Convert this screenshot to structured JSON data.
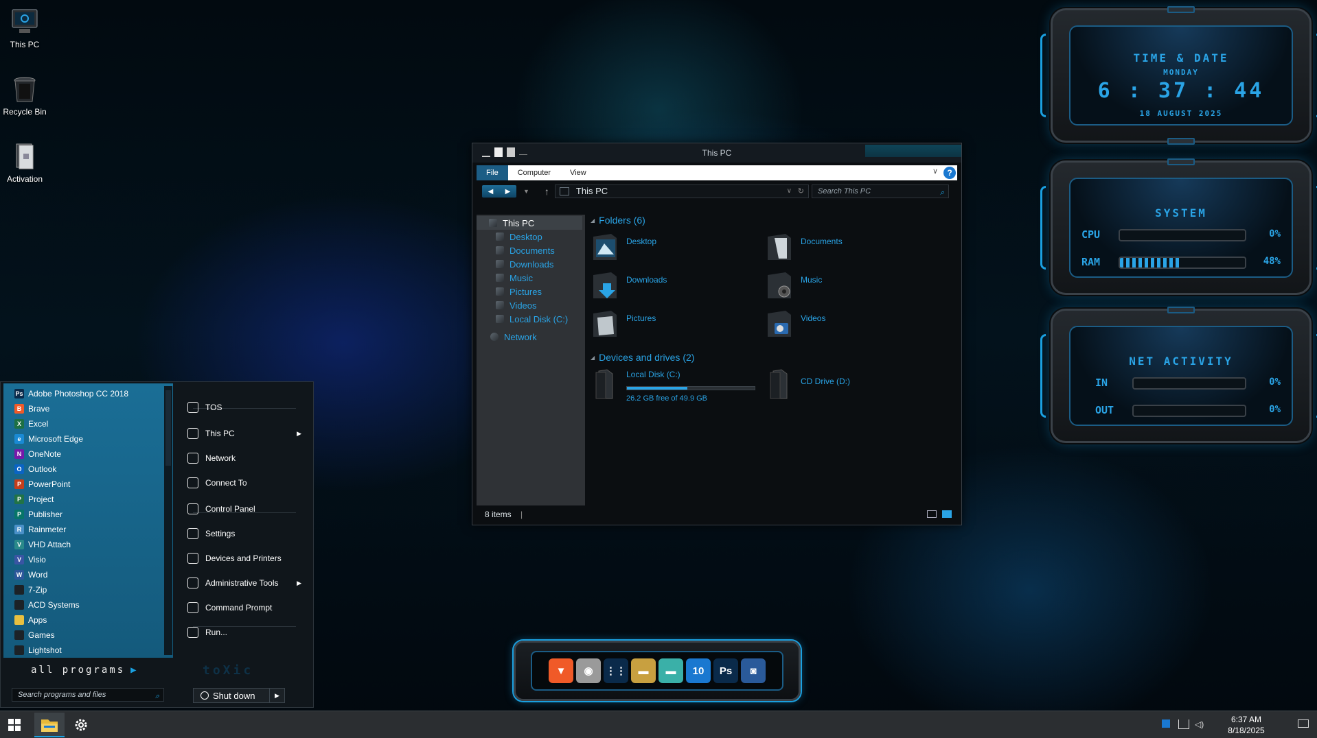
{
  "desktop": {
    "icons": [
      {
        "label": "This PC",
        "icon": "computer-icon"
      },
      {
        "label": "Recycle Bin",
        "icon": "recycle-bin-icon"
      },
      {
        "label": "Activation",
        "icon": "activation-icon"
      }
    ]
  },
  "explorer": {
    "title": "This PC",
    "ribbon_tabs": [
      "File",
      "Computer",
      "View"
    ],
    "address": "This PC",
    "search_placeholder": "Search This PC",
    "nav": {
      "root": "This PC",
      "items": [
        "Desktop",
        "Documents",
        "Downloads",
        "Music",
        "Pictures",
        "Videos",
        "Local Disk (C:)"
      ],
      "network": "Network"
    },
    "folders_heading": "Folders (6)",
    "folders": [
      "Desktop",
      "Documents",
      "Downloads",
      "Music",
      "Pictures",
      "Videos"
    ],
    "drives_heading": "Devices and drives (2)",
    "drives": [
      {
        "name": "Local Disk (C:)",
        "free": "26.2 GB free of 49.9 GB",
        "used_fraction": 0.475
      },
      {
        "name": "CD Drive (D:)"
      }
    ],
    "status": "8 items"
  },
  "start_menu": {
    "programs": [
      {
        "label": "Adobe Photoshop CC 2018",
        "icon": "photoshop-icon",
        "color": "#0a2a4a",
        "glyph": "Ps"
      },
      {
        "label": "Brave",
        "icon": "brave-icon",
        "color": "#f05a28",
        "glyph": "B"
      },
      {
        "label": "Excel",
        "icon": "excel-icon",
        "color": "#1d7044",
        "glyph": "X"
      },
      {
        "label": "Microsoft Edge",
        "icon": "edge-icon",
        "color": "#1a8ad4",
        "glyph": "e"
      },
      {
        "label": "OneNote",
        "icon": "onenote-icon",
        "color": "#7719aa",
        "glyph": "N"
      },
      {
        "label": "Outlook",
        "icon": "outlook-icon",
        "color": "#0a64c4",
        "glyph": "O"
      },
      {
        "label": "PowerPoint",
        "icon": "powerpoint-icon",
        "color": "#c43e1c",
        "glyph": "P"
      },
      {
        "label": "Project",
        "icon": "project-icon",
        "color": "#217346",
        "glyph": "P"
      },
      {
        "label": "Publisher",
        "icon": "publisher-icon",
        "color": "#077568",
        "glyph": "P"
      },
      {
        "label": "Rainmeter",
        "icon": "rainmeter-icon",
        "color": "#4a90c8",
        "glyph": "R"
      },
      {
        "label": "VHD Attach",
        "icon": "vhd-attach-icon",
        "color": "#2a8a8a",
        "glyph": "V"
      },
      {
        "label": "Visio",
        "icon": "visio-icon",
        "color": "#3955a3",
        "glyph": "V"
      },
      {
        "label": "Word",
        "icon": "word-icon",
        "color": "#2b579a",
        "glyph": "W"
      },
      {
        "label": "7-Zip",
        "icon": "folder-icon",
        "color": "#1c2227",
        "glyph": ""
      },
      {
        "label": "ACD Systems",
        "icon": "folder-icon",
        "color": "#1c2227",
        "glyph": ""
      },
      {
        "label": "Apps",
        "icon": "apps-icon",
        "color": "#e8c040",
        "glyph": ""
      },
      {
        "label": "Games",
        "icon": "folder-icon",
        "color": "#1c2227",
        "glyph": ""
      },
      {
        "label": "Lightshot",
        "icon": "folder-icon",
        "color": "#1c2227",
        "glyph": ""
      }
    ],
    "right_items": [
      {
        "label": "TOS",
        "icon": "document-icon"
      },
      {
        "label": "This PC",
        "icon": "computer-icon",
        "submenu": true
      },
      {
        "label": "Network",
        "icon": "network-icon"
      },
      {
        "label": "Connect To",
        "icon": "connect-icon"
      },
      {
        "label": "Control Panel",
        "icon": "control-panel-icon"
      },
      {
        "label": "Settings",
        "icon": "gear-icon"
      },
      {
        "label": "Devices and Printers",
        "icon": "printer-icon"
      },
      {
        "label": "Administrative Tools",
        "icon": "admin-tools-icon",
        "submenu": true
      },
      {
        "label": "Command Prompt",
        "icon": "terminal-icon"
      },
      {
        "label": "Run...",
        "icon": "run-icon"
      }
    ],
    "all_programs": "all programs",
    "brand": "toXic",
    "search_placeholder": "Search programs and files",
    "shutdown_label": "Shut down"
  },
  "widgets": {
    "time_date": {
      "title": "TIME & DATE",
      "day": "MONDAY",
      "time": "6 : 37 : 44",
      "date": "18 AUGUST 2025"
    },
    "system": {
      "title": "SYSTEM",
      "cpu_label": "CPU",
      "cpu_value": "0%",
      "cpu_fraction": 0.0,
      "ram_label": "RAM",
      "ram_value": "48%",
      "ram_fraction": 0.48
    },
    "net": {
      "title": "NET ACTIVITY",
      "in_label": "IN",
      "in_value": "0%",
      "out_label": "OUT",
      "out_value": "0%"
    }
  },
  "dock": {
    "icons": [
      {
        "name": "brave-icon",
        "glyph": "▼",
        "color": "#f05a28"
      },
      {
        "name": "disc-icon",
        "glyph": "◉",
        "color": "#9a9a9a"
      },
      {
        "name": "app-grid-icon",
        "glyph": "⋮⋮",
        "color": "#0a2a4a"
      },
      {
        "name": "drive-icon",
        "glyph": "▬",
        "color": "#c8a040"
      },
      {
        "name": "vhd-icon",
        "glyph": "▬",
        "color": "#3ab0a8"
      },
      {
        "name": "windows10-icon",
        "glyph": "10",
        "color": "#1a78d0"
      },
      {
        "name": "photoshop-icon",
        "glyph": "Ps",
        "color": "#0a2a4a"
      },
      {
        "name": "screenshot-icon",
        "glyph": "◙",
        "color": "#2a5a9a"
      }
    ]
  },
  "taskbar": {
    "time": "6:37 AM",
    "date": "8/18/2025"
  }
}
